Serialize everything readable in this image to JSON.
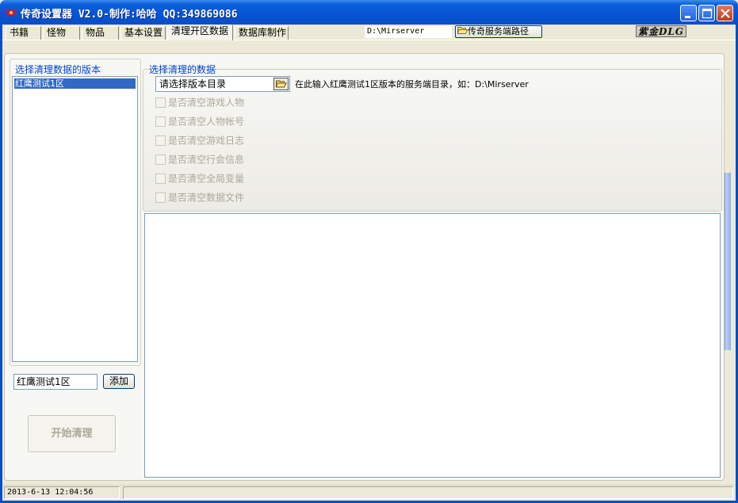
{
  "window": {
    "title": "传奇设置器 V2.0-制作:哈哈 QQ:349869086"
  },
  "tabs": [
    {
      "label": "书籍"
    },
    {
      "label": "怪物"
    },
    {
      "label": "物品"
    },
    {
      "label": "基本设置"
    },
    {
      "label": "清理开区数据",
      "active": true
    },
    {
      "label": "数据库制作"
    }
  ],
  "toolbar": {
    "server_path": "D:\\Mirserver",
    "server_path_button": "传奇服务端路径",
    "logo_text": "紫金DLG"
  },
  "left_panel": {
    "group_title": "选择清理数据的版本",
    "versions": [
      "红鹰测试1区"
    ],
    "new_version_value": "红鹰测试1区",
    "add_button": "添加",
    "start_button": "开始清理"
  },
  "right_panel": {
    "group_title": "选择清理的数据",
    "directory_combo": "请选择版本目录",
    "hint": "在此输入红鹰测试1区版本的服务端目录，如：D:\\Mirserver",
    "checkboxes": [
      {
        "label": "是否清空游戏人物",
        "checked": false
      },
      {
        "label": "是否清空人物帐号",
        "checked": false
      },
      {
        "label": "是否清空游戏日志",
        "checked": false
      },
      {
        "label": "是否清空行会信息",
        "checked": false
      },
      {
        "label": "是否清空全局变量",
        "checked": false
      },
      {
        "label": "是否清空数据文件",
        "checked": false
      }
    ],
    "log_text": ""
  },
  "statusbar": {
    "datetime": "2013-6-13 12:04:56"
  },
  "colors": {
    "titlebar": "#0553d4",
    "selection": "#316ac5",
    "group_label": "#0046d5",
    "close_button": "#c0391b"
  },
  "icons": {
    "app": "spider-icon",
    "folder": "folder-open-icon"
  }
}
